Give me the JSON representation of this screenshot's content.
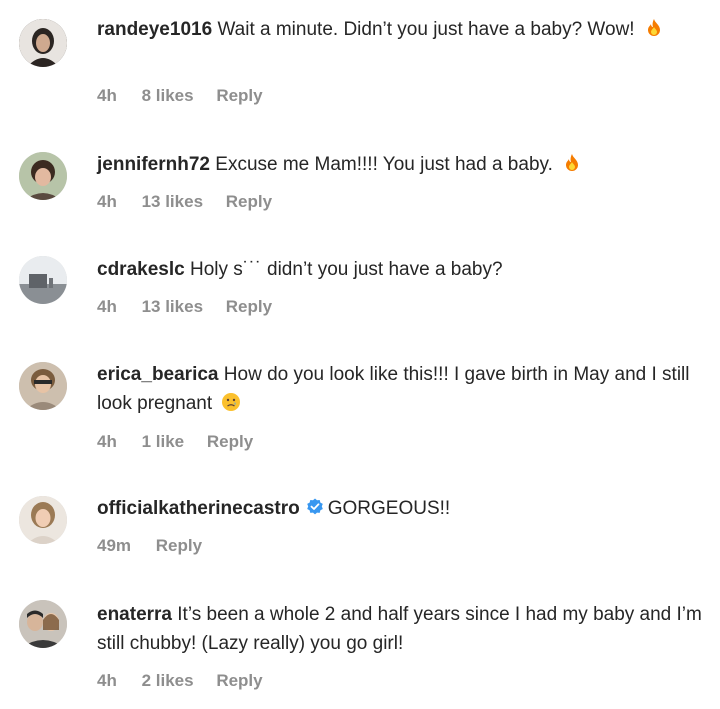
{
  "comments": [
    {
      "username": "randeye1016",
      "text": "Wait a minute. Didn’t you just have a baby? Wow!",
      "emoji": "fire-emoji",
      "time": "4h",
      "likes": "8 likes",
      "reply": "Reply"
    },
    {
      "username": "jennifernh72",
      "text": "Excuse me Mam!!!! You just had a baby.",
      "emoji": "fire-emoji",
      "time": "4h",
      "likes": "13 likes",
      "reply": "Reply"
    },
    {
      "username": "cdrakeslc",
      "text": "Holy s˙˙˙ didn’t you just have a baby?",
      "time": "4h",
      "likes": "13 likes",
      "reply": "Reply"
    },
    {
      "username": "erica_bearica",
      "text": "How do you look like this!!! I gave birth in May and I still look pregnant",
      "emoji": "crying-face-emoji",
      "time": "4h",
      "likes": "1 like",
      "reply": "Reply"
    },
    {
      "username": "officialkatherinecastro",
      "verified": true,
      "text": "GORGEOUS!!",
      "time": "49m",
      "reply": "Reply"
    },
    {
      "username": "enaterra",
      "text": "It’s been a whole 2 and half years since I had my baby and I’m still chubby! (Lazy really) you go girl!",
      "time": "4h",
      "likes": "2 likes",
      "reply": "Reply"
    }
  ],
  "colors": {
    "text": "#262626",
    "meta": "#8e8e8e",
    "verified": "#3897f0",
    "fire": "#f57c00"
  }
}
